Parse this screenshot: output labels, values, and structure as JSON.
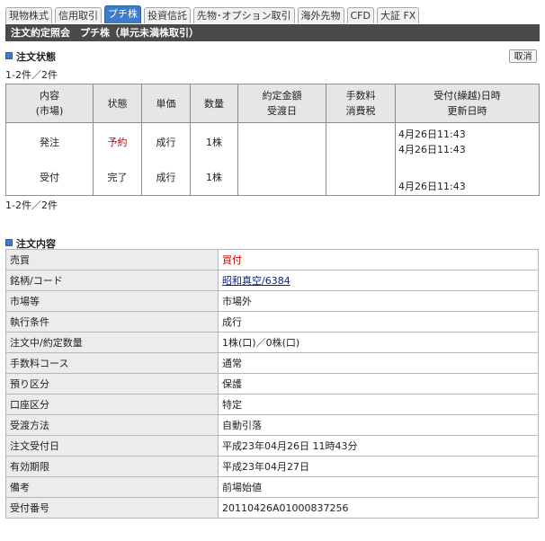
{
  "tabs": [
    {
      "label": "現物株式",
      "active": false
    },
    {
      "label": "信用取引",
      "active": false
    },
    {
      "label": "プチ株",
      "active": true
    },
    {
      "label": "投資信託",
      "active": false
    },
    {
      "label": "先物･オプション取引",
      "active": false
    },
    {
      "label": "海外先物",
      "active": false
    },
    {
      "label": "CFD",
      "active": false
    },
    {
      "label": "大証 FX",
      "active": false
    }
  ],
  "title": "注文約定照会　プチ株（単元未満株取引）",
  "status_section": {
    "heading": "注文状態",
    "cancel_label": "取消",
    "count_top": "1-2件／2件",
    "count_bottom": "1-2件／2件",
    "headers": {
      "content_1": "内容",
      "content_2": "(市場)",
      "state": "状態",
      "price": "単価",
      "qty": "数量",
      "amount_1": "約定金額",
      "amount_2": "受渡日",
      "fee_1": "手数料",
      "fee_2": "消費税",
      "date_1": "受付(繰越)日時",
      "date_2": "更新日時"
    },
    "rows": [
      {
        "content": "発注",
        "state": "予約",
        "price": "成行",
        "qty": "1株"
      },
      {
        "content": "受付",
        "state": "完了",
        "price": "成行",
        "qty": "1株"
      }
    ],
    "dates": [
      "4月26日11:43",
      "4月26日11:43",
      "4月26日11:43"
    ]
  },
  "detail_section": {
    "heading": "注文内容",
    "rows": [
      {
        "key": "売買",
        "value": "買付"
      },
      {
        "key": "銘柄/コード",
        "value": "昭和真空/6384"
      },
      {
        "key": "市場等",
        "value": "市場外"
      },
      {
        "key": "執行条件",
        "value": "成行"
      },
      {
        "key": "注文中/約定数量",
        "value": "1株(口)／0株(口)"
      },
      {
        "key": "手数料コース",
        "value": "通常"
      },
      {
        "key": "預り区分",
        "value": "保護"
      },
      {
        "key": "口座区分",
        "value": "特定"
      },
      {
        "key": "受渡方法",
        "value": "自動引落"
      },
      {
        "key": "注文受付日",
        "value": "平成23年04月26日 11時43分"
      },
      {
        "key": "有効期限",
        "value": "平成23年04月27日"
      },
      {
        "key": "備考",
        "value": "前場始値"
      },
      {
        "key": "受付番号",
        "value": "20110426A01000837256"
      }
    ]
  },
  "colors": {
    "active_tab": "#3d7cc9",
    "title_bg": "#4a4a4a",
    "sell_buy": "#cc0000",
    "reserve": "#cc0000",
    "link": "#13247a"
  }
}
